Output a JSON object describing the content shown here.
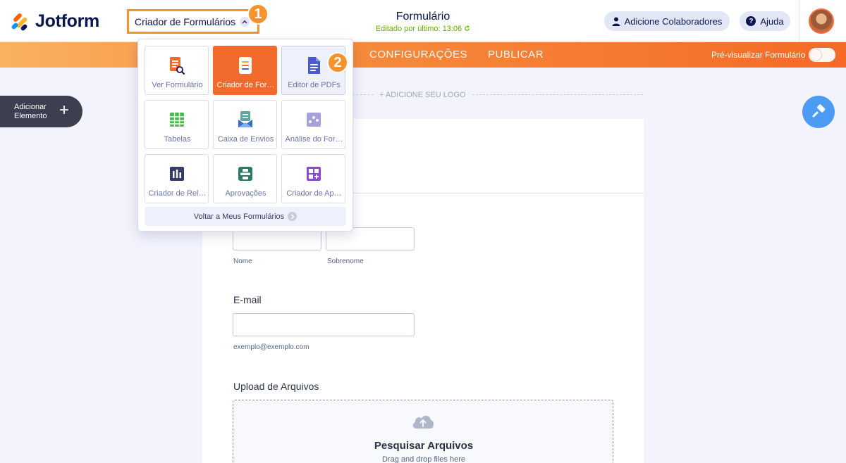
{
  "header": {
    "brand": "Jotform",
    "builder_selector": "Criador de Formulários",
    "form_title": "Formulário",
    "edited": "Editado por último: 13:06",
    "collab_button": "Adicione Colaboradores",
    "help_button": "Ajuda",
    "help_icon_glyph": "?"
  },
  "badges": {
    "one": "1",
    "two": "2"
  },
  "nav": {
    "items": [
      "CONFIGURAÇÕES",
      "PUBLICAR"
    ],
    "preview_label": "Pré-visualizar Formulário"
  },
  "left_panel": {
    "add_element": "Adicionar Elemento",
    "add_icon": "+"
  },
  "dropdown": {
    "tiles": [
      {
        "label": "Ver Formulário",
        "icon": "form-view-icon",
        "color": "#f26b2d"
      },
      {
        "label": "Criador de For…",
        "icon": "form-builder-icon",
        "color": "#ffffff"
      },
      {
        "label": "Editor de PDFs",
        "icon": "pdf-editor-icon",
        "color": "#4a5bcf"
      },
      {
        "label": "Tabelas",
        "icon": "tables-icon",
        "color": "#4bb64b"
      },
      {
        "label": "Caixa de Envios",
        "icon": "inbox-icon",
        "color": "#5aa8a0"
      },
      {
        "label": "Análise do For…",
        "icon": "analytics-icon",
        "color": "#a6a2d9"
      },
      {
        "label": "Criador de Rel…",
        "icon": "report-builder-icon",
        "color": "#343c6a"
      },
      {
        "label": "Aprovações",
        "icon": "approvals-icon",
        "color": "#2d7a66"
      },
      {
        "label": "Criador de Ap…",
        "icon": "app-builder-icon",
        "color": "#8b4ad6"
      }
    ],
    "back_button": "Voltar a Meus Formulários"
  },
  "canvas": {
    "logo_placeholder": "+ ADICIONE SEU LOGO",
    "first_name_sublabel": "Nome",
    "last_name_sublabel": "Sobrenome",
    "email_label": "E-mail",
    "email_sublabel": "exemplo@exemplo.com",
    "upload_label": "Upload de Arquivos",
    "upload_title": "Pesquisar Arquivos",
    "upload_sub": "Drag and drop files here"
  },
  "colors": {
    "accent": "#f7922c",
    "brand_orange": "#ff6100",
    "navy": "#0a1551"
  }
}
